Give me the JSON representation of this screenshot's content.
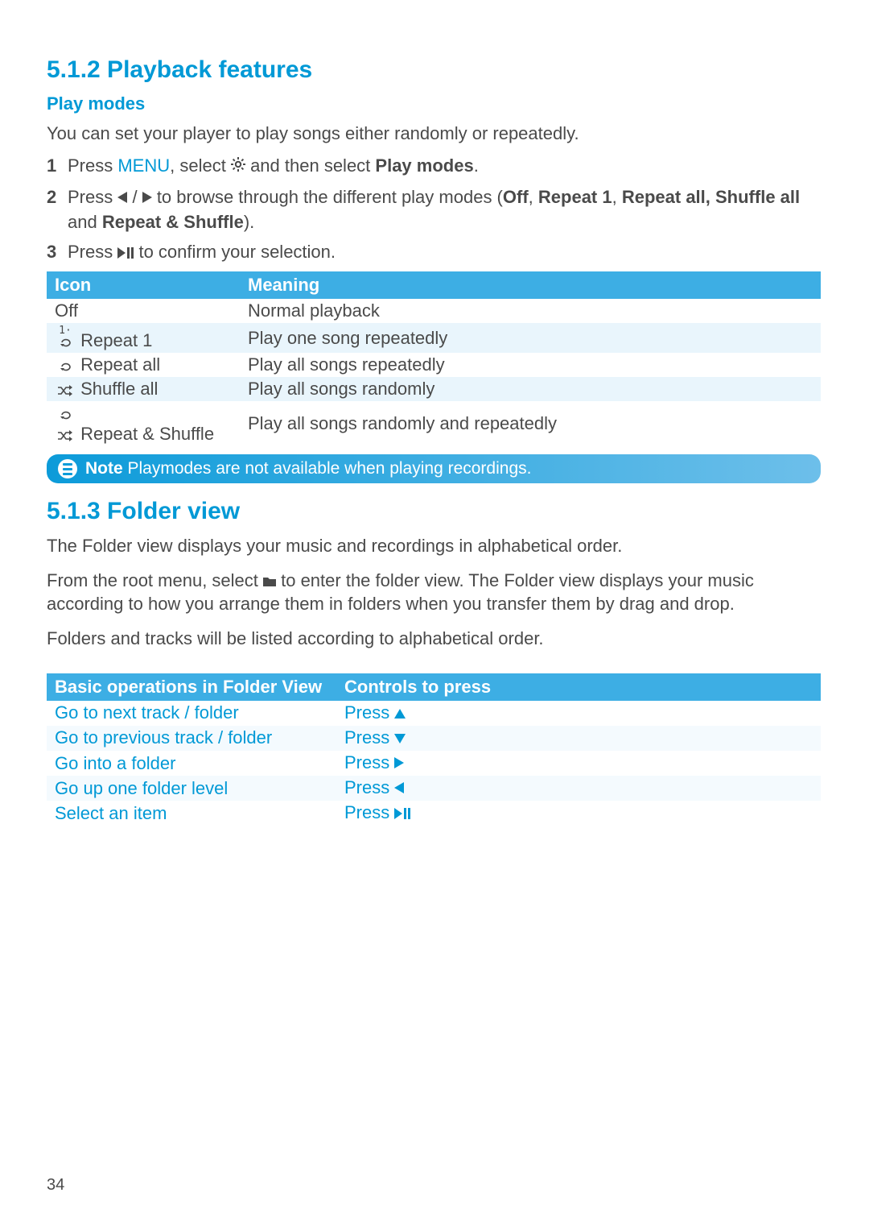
{
  "section1": {
    "heading": "5.1.2  Playback features",
    "subheading": "Play modes",
    "intro": "You can set your player to play songs either randomly or repeatedly.",
    "steps": {
      "s1_num": "1",
      "s1a": "Press ",
      "s1_menu": "MENU",
      "s1b": ", select ",
      "s1c": " and then select ",
      "s1d": "Play modes",
      "s1e": ".",
      "s2_num": "2",
      "s2a": "Press ",
      "s2b": " / ",
      "s2c": " to browse through the different play modes (",
      "s2d": "Off",
      "s2e": ", ",
      "s2f": "Repeat 1",
      "s2g": ", ",
      "s2h": "Repeat all, Shuffle all",
      "s2i": " and ",
      "s2j": "Repeat & Shuffle",
      "s2k": ").",
      "s3_num": "3",
      "s3a": "Press ",
      "s3b": " to confirm your selection."
    },
    "table": {
      "hdr1": "Icon",
      "hdr2": "Meaning",
      "rows": [
        {
          "icon_label": "Off",
          "meaning": "Normal playback"
        },
        {
          "icon_label": "Repeat 1",
          "meaning": "Play one song repeatedly"
        },
        {
          "icon_label": "Repeat all",
          "meaning": "Play all songs repeatedly"
        },
        {
          "icon_label": "Shuffle all",
          "meaning": "Play all songs randomly"
        },
        {
          "icon_label": "Repeat & Shuffle",
          "meaning": "Play all songs randomly and repeatedly"
        }
      ]
    },
    "note_label": "Note",
    "note_text": " Playmodes are not available when playing recordings."
  },
  "section2": {
    "heading": "5.1.3  Folder view",
    "p1": "The Folder view displays your music and recordings in alphabetical order.",
    "p2a": "From the root menu, select ",
    "p2b": " to enter the folder view. The Folder view displays your music according to how you arrange them in folders when you transfer them by drag and drop.",
    "p3": "Folders and tracks will be listed according to alphabetical order.",
    "table": {
      "hdr1": "Basic operations in Folder View",
      "hdr2": "Controls to press",
      "press": "Press ",
      "rows": [
        {
          "op": "Go to next track / folder"
        },
        {
          "op": "Go to previous track / folder"
        },
        {
          "op": "Go into a folder"
        },
        {
          "op": "Go up one folder level"
        },
        {
          "op": "Select an item"
        }
      ]
    }
  },
  "page_number": "34"
}
